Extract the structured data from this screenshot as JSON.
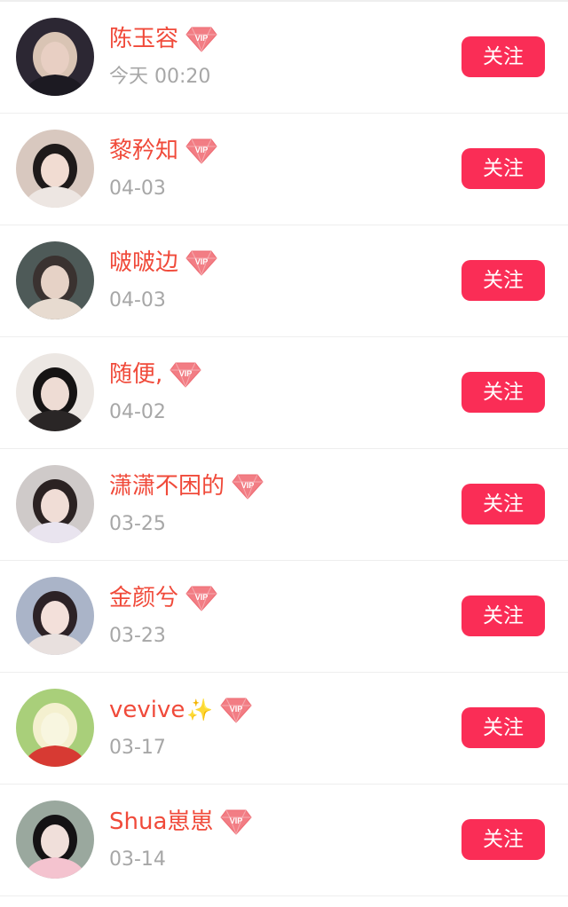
{
  "colors": {
    "name": "#f04a3a",
    "time": "#a7a7a7",
    "button_bg": "#fa2d56",
    "button_text": "#ffffff",
    "divider": "#eeeeee",
    "vip_badge": "#f0707a"
  },
  "vip_badge_text": "VIP",
  "users": [
    {
      "name": "陈玉容",
      "suffix": "",
      "time": "今天 00:20",
      "follow_label": "关注",
      "avatar": {
        "bg": "#2c2733",
        "hair": "#d9c4b4",
        "skin": "#e8cfc3",
        "cloth": "#1c1a22"
      }
    },
    {
      "name": "黎矜知",
      "suffix": "",
      "time": "04-03",
      "follow_label": "关注",
      "avatar": {
        "bg": "#d8c8bf",
        "hair": "#1e1a1a",
        "skin": "#f1dcd2",
        "cloth": "#ede6e2"
      }
    },
    {
      "name": "啵啵边",
      "suffix": "",
      "time": "04-03",
      "follow_label": "关注",
      "avatar": {
        "bg": "#4e5a58",
        "hair": "#3a3230",
        "skin": "#e6d2c6",
        "cloth": "#e7dbd0"
      }
    },
    {
      "name": "随便,",
      "suffix": "",
      "time": "04-02",
      "follow_label": "关注",
      "avatar": {
        "bg": "#ece7e3",
        "hair": "#161414",
        "skin": "#eedcd4",
        "cloth": "#2a2626"
      }
    },
    {
      "name": "潇潇不困的",
      "suffix": "",
      "time": "03-25",
      "follow_label": "关注",
      "avatar": {
        "bg": "#cfcac9",
        "hair": "#2b2222",
        "skin": "#f0ddd6",
        "cloth": "#e9e4ef"
      }
    },
    {
      "name": "金颜兮",
      "suffix": "",
      "time": "03-23",
      "follow_label": "关注",
      "avatar": {
        "bg": "#aab4c8",
        "hair": "#2c2226",
        "skin": "#f3e0da",
        "cloth": "#e8e0de"
      }
    },
    {
      "name": "vevive",
      "suffix": "✨",
      "time": "03-17",
      "follow_label": "关注",
      "avatar": {
        "bg": "#a9cf7a",
        "hair": "#f4f0cf",
        "skin": "#f8f6e0",
        "cloth": "#d73a33"
      }
    },
    {
      "name": "Shua崽崽",
      "suffix": "",
      "time": "03-14",
      "follow_label": "关注",
      "avatar": {
        "bg": "#9aa89e",
        "hair": "#141214",
        "skin": "#f0dfda",
        "cloth": "#f4c3cf"
      }
    }
  ]
}
